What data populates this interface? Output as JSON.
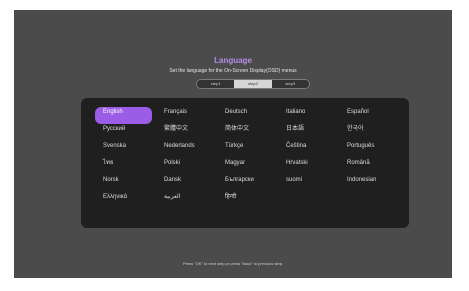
{
  "header": {
    "title": "Language",
    "subtitle": "Set the language for the On-Screen Display(OSD) menus"
  },
  "steps": [
    {
      "label": "step1"
    },
    {
      "label": "step2"
    },
    {
      "label": "step3"
    }
  ],
  "active_step": "step2",
  "languages": [
    "English",
    "Français",
    "Deutsch",
    "Italiano",
    "Español",
    "Русский",
    "繁體中文",
    "简体中文",
    "日本語",
    "한국어",
    "Svenska",
    "Nederlands",
    "Türkçe",
    "Čeština",
    "Português",
    "ไทย",
    "Polski",
    "Magyar",
    "Hrvatski",
    "Română",
    "Norsk",
    "Dansk",
    "Български",
    "suomi",
    "Indonesian",
    "Ελληνικά",
    "العربية",
    "हिन्दी"
  ],
  "selected_language": "English",
  "footer": {
    "hint": "Press \"OK\" to next step,or press \"back\" to previous step."
  },
  "colors": {
    "accent": "#9b5de5",
    "title": "#b58ce6",
    "background": "#4b4b4b",
    "panel": "#1f1f1f"
  }
}
